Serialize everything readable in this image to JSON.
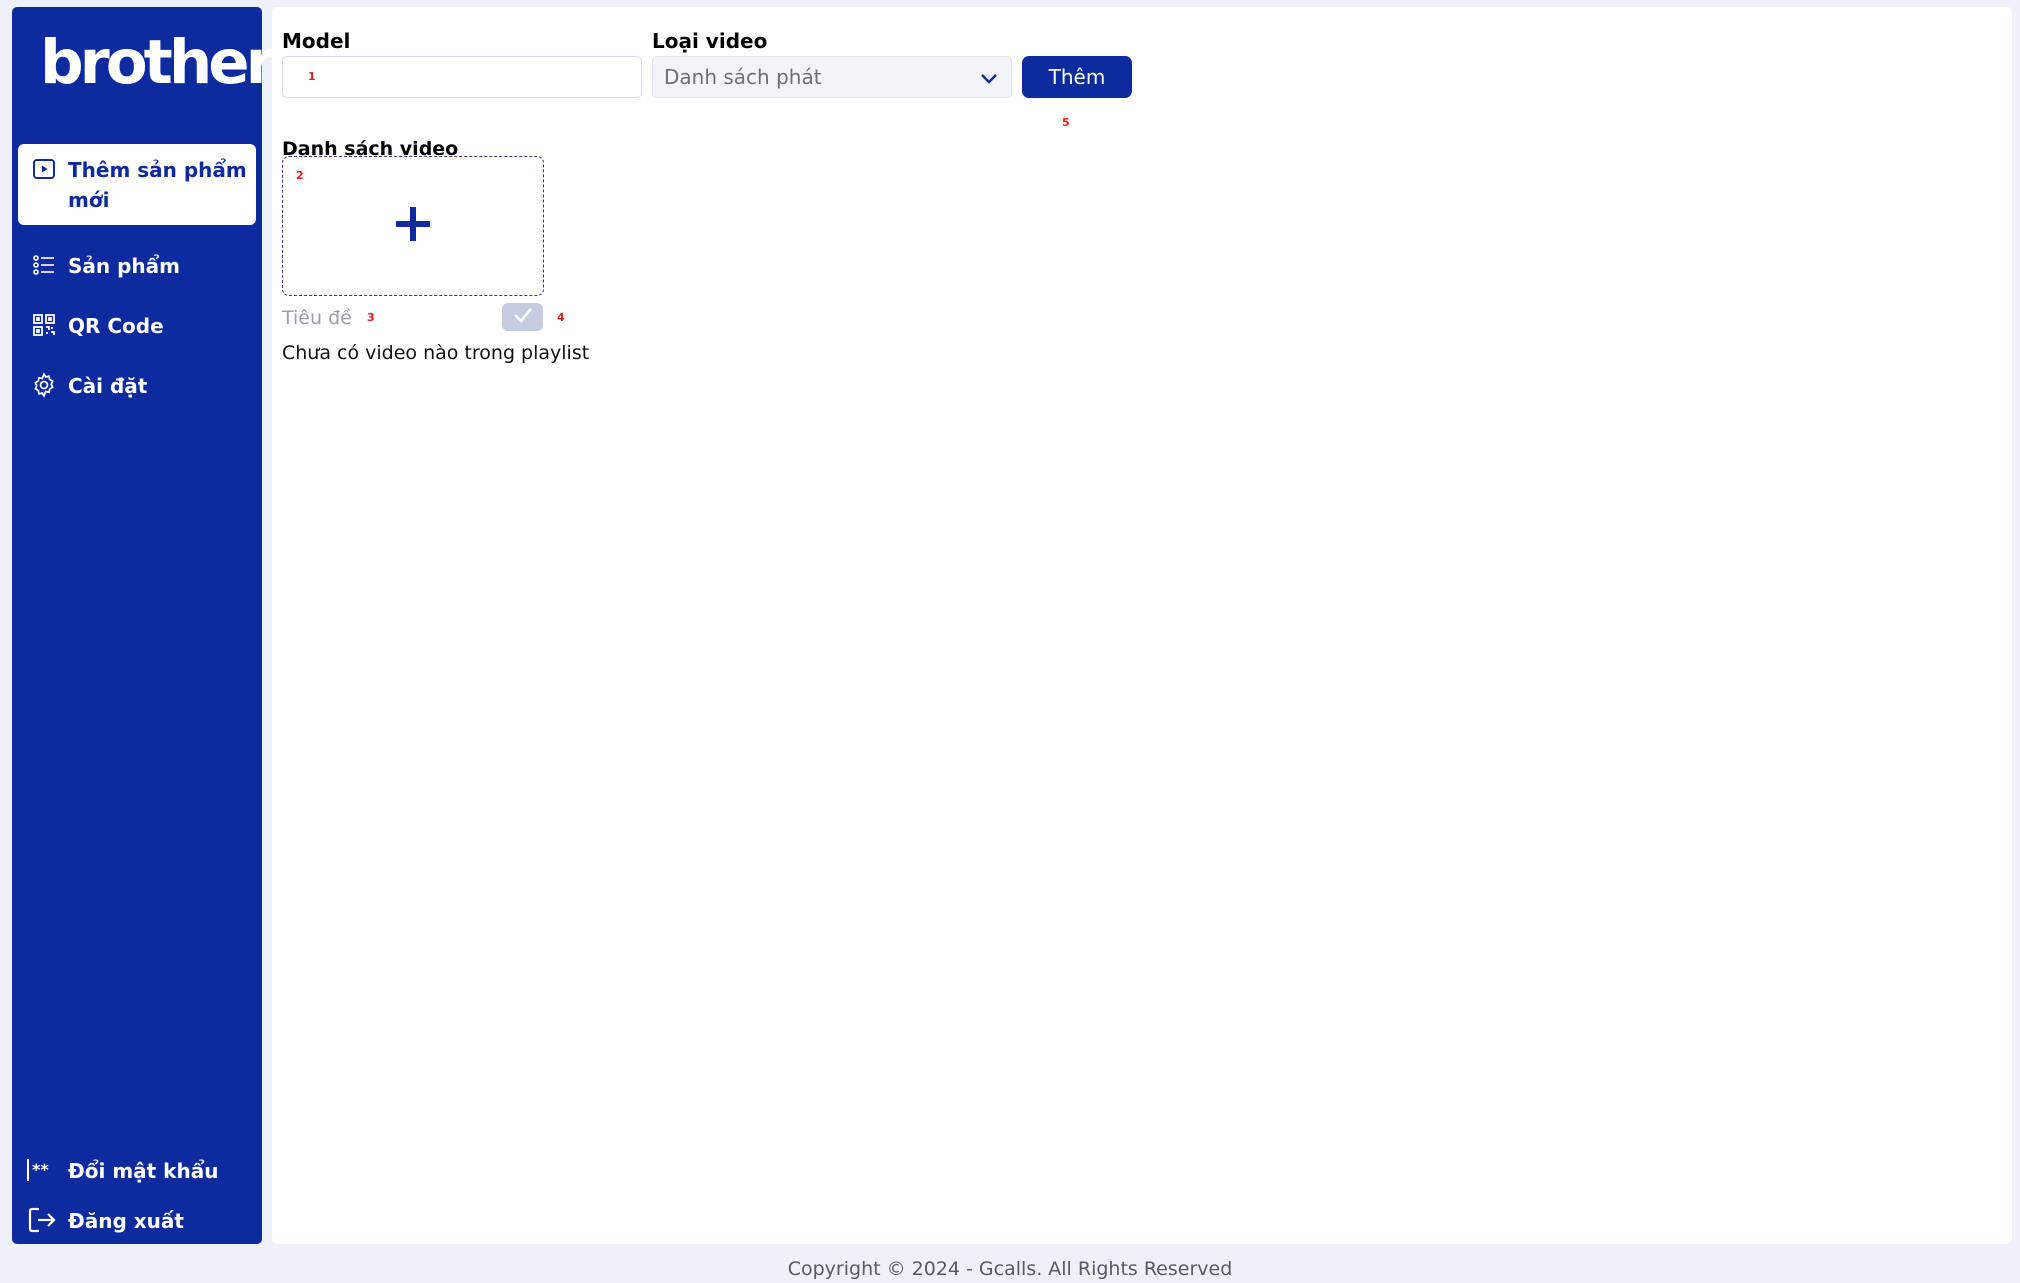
{
  "brand": {
    "logo_text": "brother",
    "primary_color": "#0d2a9e"
  },
  "sidebar": {
    "items": [
      {
        "label": "Thêm sản phẩm mới",
        "icon": "play-square-icon",
        "active": true
      },
      {
        "label": "Sản phẩm",
        "icon": "list-icon",
        "active": false
      },
      {
        "label": "QR Code",
        "icon": "qr-code-icon",
        "active": false
      },
      {
        "label": "Cài đặt",
        "icon": "gear-icon",
        "active": false
      }
    ],
    "bottom_items": [
      {
        "label": "Đổi mật khẩu",
        "icon": "password-icon"
      },
      {
        "label": "Đăng xuất",
        "icon": "logout-icon"
      }
    ]
  },
  "form": {
    "model_label": "Model",
    "model_value": "",
    "video_type_label": "Loại video",
    "video_type_selected": "Danh sách phát",
    "add_button_label": "Thêm",
    "video_list_label": "Danh sách video",
    "title_placeholder": "Tiêu đề",
    "empty_playlist_text": "Chưa có video nào trong playlist"
  },
  "markers": [
    "1",
    "2",
    "3",
    "4",
    "5"
  ],
  "footer": {
    "copyright": "Copyright © 2024 - Gcalls. All Rights Reserved"
  }
}
